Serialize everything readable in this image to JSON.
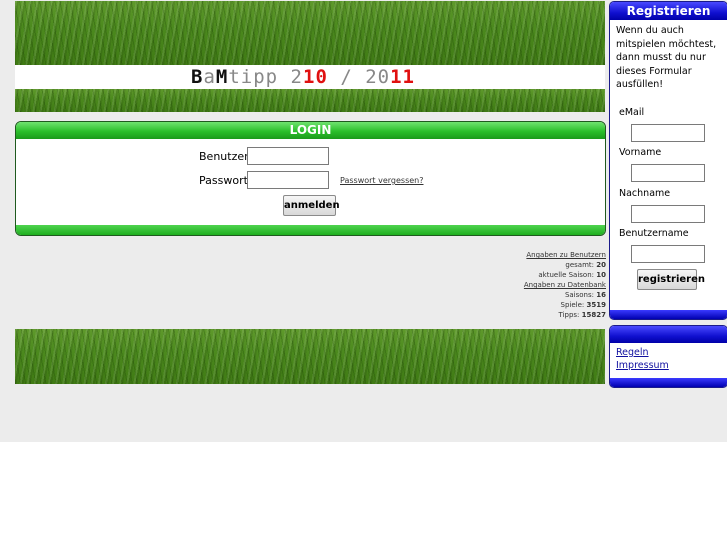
{
  "logo": {
    "p1": "B",
    "p2": "a",
    "p3": "M",
    "p4": "tipp 2",
    "p5": "10",
    "p6": " / 20",
    "p7": "11"
  },
  "login": {
    "title": "LOGIN",
    "username_label": "Benutzer",
    "password_label": "Passwort",
    "forgot_link": "Passwort vergessen?",
    "submit_label": "anmelden",
    "username_value": "",
    "password_value": ""
  },
  "stats": {
    "users_link": "Angaben zu Benutzern",
    "total_label": "gesamt:",
    "total_value": "20",
    "season_label": "aktuelle Saison:",
    "season_value": "10",
    "db_link": "Angaben zu Datenbank",
    "seasons_label": "Saisons:",
    "seasons_value": "16",
    "games_label": "Spiele:",
    "games_value": "3519",
    "tips_label": "Tipps:",
    "tips_value": "15827"
  },
  "register": {
    "title": "Registrieren",
    "intro": "Wenn du auch mitspielen möchtest, dann musst du nur dieses Formular ausfüllen!",
    "email_label": "eMail",
    "firstname_label": "Vorname",
    "lastname_label": "Nachname",
    "username_label": "Benutzername",
    "submit_label": "registrieren"
  },
  "links": {
    "rules": "Regeln",
    "imprint": "Impressum"
  },
  "colors": {
    "green_header": "#2bbf2b",
    "blue_header": "#1010d0",
    "logo_red": "#e01010"
  }
}
